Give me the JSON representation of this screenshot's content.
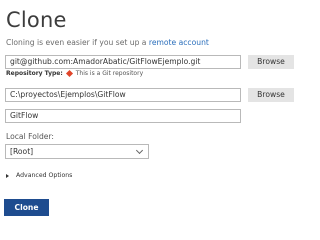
{
  "title": "Clone",
  "subtitle": {
    "text": "Cloning is even easier if you set up a ",
    "link": "remote account"
  },
  "source": {
    "url_value": "git@github.com:AmadorAbatic/GitFlowEjemplo.git",
    "browse_label": "Browse",
    "repo_type_key": "Repository Type:",
    "repo_type_icon": "git-icon",
    "repo_type_value": "This is a Git repository"
  },
  "destination": {
    "path_value": "C:\\proyectos\\Ejemplos\\GitFlow",
    "browse_label": "Browse",
    "name_value": "GitFlow"
  },
  "local_folder": {
    "label": "Local Folder:",
    "selected": "[Root]"
  },
  "advanced_label": "Advanced Options",
  "clone_button": "Clone",
  "colors": {
    "accent": "#1e4c8f",
    "link": "#2a6ebb",
    "git_icon": "#e0452a"
  }
}
